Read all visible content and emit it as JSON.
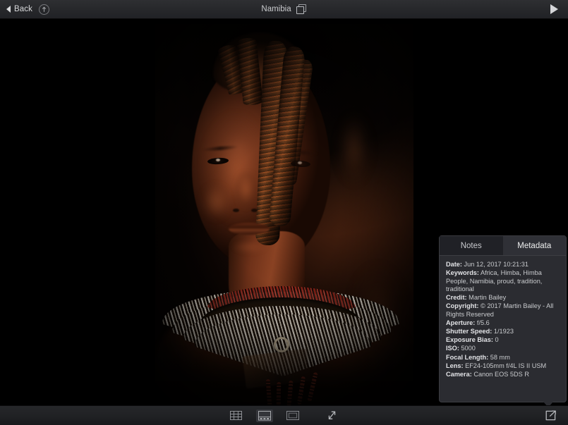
{
  "header": {
    "back_label": "Back",
    "back_icon": "chevron-left-icon",
    "info_icon": "info-circle-icon",
    "title": "Namibia",
    "window_icon": "duplicate-window-icon",
    "next_icon": "play-next-icon"
  },
  "photo": {
    "alt": "Portrait of a Himba person in Namibia wearing a beaded necklace"
  },
  "panel": {
    "tabs": [
      {
        "label": "Notes",
        "active": false
      },
      {
        "label": "Metadata",
        "active": true
      }
    ],
    "metadata": [
      {
        "key": "Date:",
        "value": "Jun 12, 2017 10:21:31"
      },
      {
        "key": "Keywords:",
        "value": "Africa, Himba, Himba People, Namibia, proud, tradition, traditional"
      },
      {
        "key": "Credit:",
        "value": "Martin Bailey"
      },
      {
        "key": "Copyright:",
        "value": "© 2017 Martin Bailey - All Rights Reserved"
      },
      {
        "key": "Aperture:",
        "value": "f/5.6"
      },
      {
        "key": "Shutter Speed:",
        "value": "1/1923"
      },
      {
        "key": "Exposure Bias:",
        "value": "0"
      },
      {
        "key": "ISO:",
        "value": "5000"
      },
      {
        "key": "Focal Length:",
        "value": "58 mm"
      },
      {
        "key": "Lens:",
        "value": "EF24-105mm f/4L IS II USM"
      },
      {
        "key": "Camera:",
        "value": "Canon EOS 5DS R"
      }
    ]
  },
  "bottombar": {
    "buttons": [
      {
        "name": "grid-view-icon",
        "selected": false
      },
      {
        "name": "filmstrip-view-icon",
        "selected": true
      },
      {
        "name": "single-view-icon",
        "selected": false
      },
      {
        "name": "fullscreen-icon",
        "selected": false
      }
    ],
    "export_icon": "open-external-icon"
  },
  "colors": {
    "chrome": "#26272a",
    "panel": "#2b2c31",
    "tab_active": "#2f3036",
    "tab_inactive": "#202126",
    "text": "#c8cacd",
    "stage": "#000000"
  }
}
